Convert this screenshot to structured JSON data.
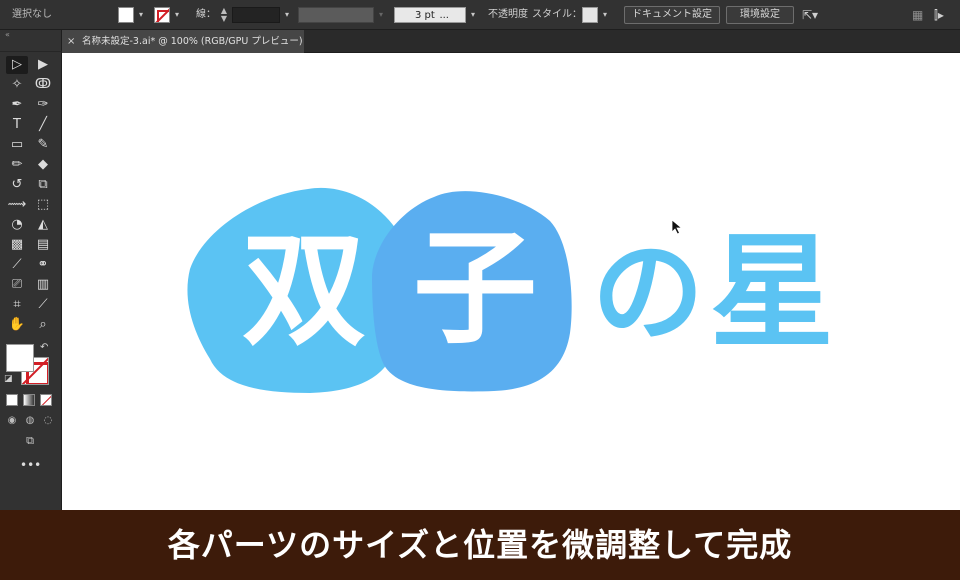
{
  "control_bar": {
    "selection": "選択なし",
    "stroke_label": "線：",
    "stroke_weight": "3 pt",
    "stroke_weight_suffix": "...",
    "opacity_label": "不透明度",
    "style_label": "スタイル：",
    "document_settings": "ドキュメント設定",
    "preferences": "環境設定"
  },
  "document_tab": {
    "close": "×",
    "title": "名称未設定-3.ai* @ 100% (RGB/GPU プレビュー)"
  },
  "artwork": {
    "char_1": "双",
    "char_2": "子",
    "char_3": "の",
    "char_4": "星",
    "color_blob_1": "#5bc3f3",
    "color_blob_2": "#5aaef0",
    "color_text": "#5bc3f3"
  },
  "caption": "各パーツのサイズと位置を微調整して完成",
  "colors": {
    "ui_bg": "#323232",
    "canvas": "#ffffff",
    "caption_bg": "#3d1b0a",
    "none_red": "#d21f26"
  }
}
